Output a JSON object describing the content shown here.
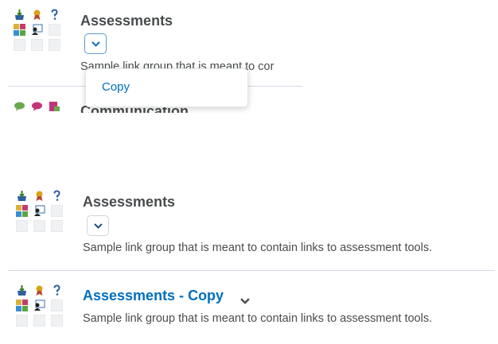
{
  "section1": {
    "title": "Assessments",
    "description_partial": "Sample link group that is meant to cor",
    "menu": {
      "items": [
        {
          "label": "Copy"
        }
      ]
    }
  },
  "section2": {
    "title": "Communication"
  },
  "section3": {
    "title": "Assessments",
    "description": "Sample link group that is meant to contain links to assessment tools."
  },
  "section4": {
    "title": "Assessments - Copy",
    "description": "Sample link group that is meant to contain links to assessment tools."
  },
  "icons": {
    "assessment_set": [
      "inbox-tray-icon",
      "award-ribbon-icon",
      "question-mark-icon",
      "color-grid-icon",
      "user-id-card-icon",
      "blank-slot",
      "blank-slot",
      "blank-slot",
      "blank-slot"
    ],
    "communication_set": [
      "chat-bubble-icon",
      "chat-bubble-icon",
      "chat-document-icon"
    ]
  },
  "colors": {
    "link": "#006fbf",
    "text": "#494c4e",
    "divider": "#d3d9e3"
  }
}
